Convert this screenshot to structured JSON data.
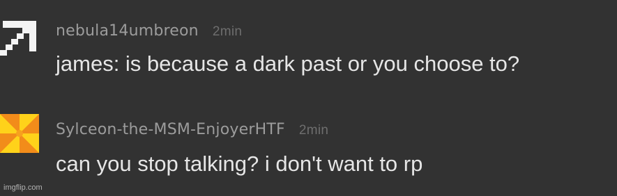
{
  "messages": [
    {
      "username": "nebula14umbreon",
      "time": "2min",
      "text": "james: is because a dark past or you choose to?",
      "avatar_icon": "pixel-arrow-icon"
    },
    {
      "username": "Sylceon-the-MSM-EnjoyerHTF",
      "time": "2min",
      "text": "can you stop talking? i don't want to rp",
      "avatar_icon": "orange-swirl-icon"
    }
  ],
  "watermark": "imgflip.com",
  "colors": {
    "background": "#323232",
    "username": "#9c9c9c",
    "time": "#6e6e6e",
    "text": "#e6e6e6",
    "avatar_orange": "#f28c1a",
    "avatar_yellow": "#ffd21a"
  }
}
